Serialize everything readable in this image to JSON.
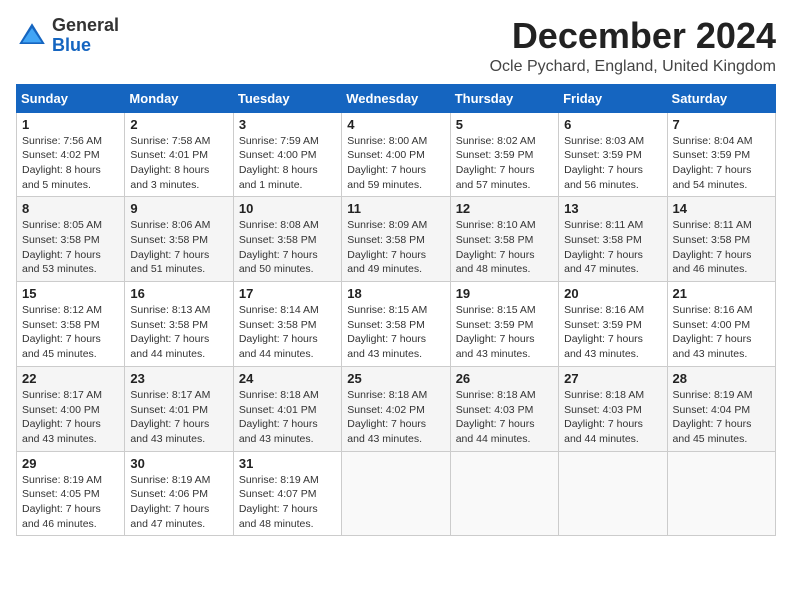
{
  "logo": {
    "text_general": "General",
    "text_blue": "Blue"
  },
  "header": {
    "month": "December 2024",
    "location": "Ocle Pychard, England, United Kingdom"
  },
  "weekdays": [
    "Sunday",
    "Monday",
    "Tuesday",
    "Wednesday",
    "Thursday",
    "Friday",
    "Saturday"
  ],
  "weeks": [
    [
      {
        "day": "1",
        "sunrise": "Sunrise: 7:56 AM",
        "sunset": "Sunset: 4:02 PM",
        "daylight": "Daylight: 8 hours and 5 minutes."
      },
      {
        "day": "2",
        "sunrise": "Sunrise: 7:58 AM",
        "sunset": "Sunset: 4:01 PM",
        "daylight": "Daylight: 8 hours and 3 minutes."
      },
      {
        "day": "3",
        "sunrise": "Sunrise: 7:59 AM",
        "sunset": "Sunset: 4:00 PM",
        "daylight": "Daylight: 8 hours and 1 minute."
      },
      {
        "day": "4",
        "sunrise": "Sunrise: 8:00 AM",
        "sunset": "Sunset: 4:00 PM",
        "daylight": "Daylight: 7 hours and 59 minutes."
      },
      {
        "day": "5",
        "sunrise": "Sunrise: 8:02 AM",
        "sunset": "Sunset: 3:59 PM",
        "daylight": "Daylight: 7 hours and 57 minutes."
      },
      {
        "day": "6",
        "sunrise": "Sunrise: 8:03 AM",
        "sunset": "Sunset: 3:59 PM",
        "daylight": "Daylight: 7 hours and 56 minutes."
      },
      {
        "day": "7",
        "sunrise": "Sunrise: 8:04 AM",
        "sunset": "Sunset: 3:59 PM",
        "daylight": "Daylight: 7 hours and 54 minutes."
      }
    ],
    [
      {
        "day": "8",
        "sunrise": "Sunrise: 8:05 AM",
        "sunset": "Sunset: 3:58 PM",
        "daylight": "Daylight: 7 hours and 53 minutes."
      },
      {
        "day": "9",
        "sunrise": "Sunrise: 8:06 AM",
        "sunset": "Sunset: 3:58 PM",
        "daylight": "Daylight: 7 hours and 51 minutes."
      },
      {
        "day": "10",
        "sunrise": "Sunrise: 8:08 AM",
        "sunset": "Sunset: 3:58 PM",
        "daylight": "Daylight: 7 hours and 50 minutes."
      },
      {
        "day": "11",
        "sunrise": "Sunrise: 8:09 AM",
        "sunset": "Sunset: 3:58 PM",
        "daylight": "Daylight: 7 hours and 49 minutes."
      },
      {
        "day": "12",
        "sunrise": "Sunrise: 8:10 AM",
        "sunset": "Sunset: 3:58 PM",
        "daylight": "Daylight: 7 hours and 48 minutes."
      },
      {
        "day": "13",
        "sunrise": "Sunrise: 8:11 AM",
        "sunset": "Sunset: 3:58 PM",
        "daylight": "Daylight: 7 hours and 47 minutes."
      },
      {
        "day": "14",
        "sunrise": "Sunrise: 8:11 AM",
        "sunset": "Sunset: 3:58 PM",
        "daylight": "Daylight: 7 hours and 46 minutes."
      }
    ],
    [
      {
        "day": "15",
        "sunrise": "Sunrise: 8:12 AM",
        "sunset": "Sunset: 3:58 PM",
        "daylight": "Daylight: 7 hours and 45 minutes."
      },
      {
        "day": "16",
        "sunrise": "Sunrise: 8:13 AM",
        "sunset": "Sunset: 3:58 PM",
        "daylight": "Daylight: 7 hours and 44 minutes."
      },
      {
        "day": "17",
        "sunrise": "Sunrise: 8:14 AM",
        "sunset": "Sunset: 3:58 PM",
        "daylight": "Daylight: 7 hours and 44 minutes."
      },
      {
        "day": "18",
        "sunrise": "Sunrise: 8:15 AM",
        "sunset": "Sunset: 3:58 PM",
        "daylight": "Daylight: 7 hours and 43 minutes."
      },
      {
        "day": "19",
        "sunrise": "Sunrise: 8:15 AM",
        "sunset": "Sunset: 3:59 PM",
        "daylight": "Daylight: 7 hours and 43 minutes."
      },
      {
        "day": "20",
        "sunrise": "Sunrise: 8:16 AM",
        "sunset": "Sunset: 3:59 PM",
        "daylight": "Daylight: 7 hours and 43 minutes."
      },
      {
        "day": "21",
        "sunrise": "Sunrise: 8:16 AM",
        "sunset": "Sunset: 4:00 PM",
        "daylight": "Daylight: 7 hours and 43 minutes."
      }
    ],
    [
      {
        "day": "22",
        "sunrise": "Sunrise: 8:17 AM",
        "sunset": "Sunset: 4:00 PM",
        "daylight": "Daylight: 7 hours and 43 minutes."
      },
      {
        "day": "23",
        "sunrise": "Sunrise: 8:17 AM",
        "sunset": "Sunset: 4:01 PM",
        "daylight": "Daylight: 7 hours and 43 minutes."
      },
      {
        "day": "24",
        "sunrise": "Sunrise: 8:18 AM",
        "sunset": "Sunset: 4:01 PM",
        "daylight": "Daylight: 7 hours and 43 minutes."
      },
      {
        "day": "25",
        "sunrise": "Sunrise: 8:18 AM",
        "sunset": "Sunset: 4:02 PM",
        "daylight": "Daylight: 7 hours and 43 minutes."
      },
      {
        "day": "26",
        "sunrise": "Sunrise: 8:18 AM",
        "sunset": "Sunset: 4:03 PM",
        "daylight": "Daylight: 7 hours and 44 minutes."
      },
      {
        "day": "27",
        "sunrise": "Sunrise: 8:18 AM",
        "sunset": "Sunset: 4:03 PM",
        "daylight": "Daylight: 7 hours and 44 minutes."
      },
      {
        "day": "28",
        "sunrise": "Sunrise: 8:19 AM",
        "sunset": "Sunset: 4:04 PM",
        "daylight": "Daylight: 7 hours and 45 minutes."
      }
    ],
    [
      {
        "day": "29",
        "sunrise": "Sunrise: 8:19 AM",
        "sunset": "Sunset: 4:05 PM",
        "daylight": "Daylight: 7 hours and 46 minutes."
      },
      {
        "day": "30",
        "sunrise": "Sunrise: 8:19 AM",
        "sunset": "Sunset: 4:06 PM",
        "daylight": "Daylight: 7 hours and 47 minutes."
      },
      {
        "day": "31",
        "sunrise": "Sunrise: 8:19 AM",
        "sunset": "Sunset: 4:07 PM",
        "daylight": "Daylight: 7 hours and 48 minutes."
      },
      null,
      null,
      null,
      null
    ]
  ]
}
